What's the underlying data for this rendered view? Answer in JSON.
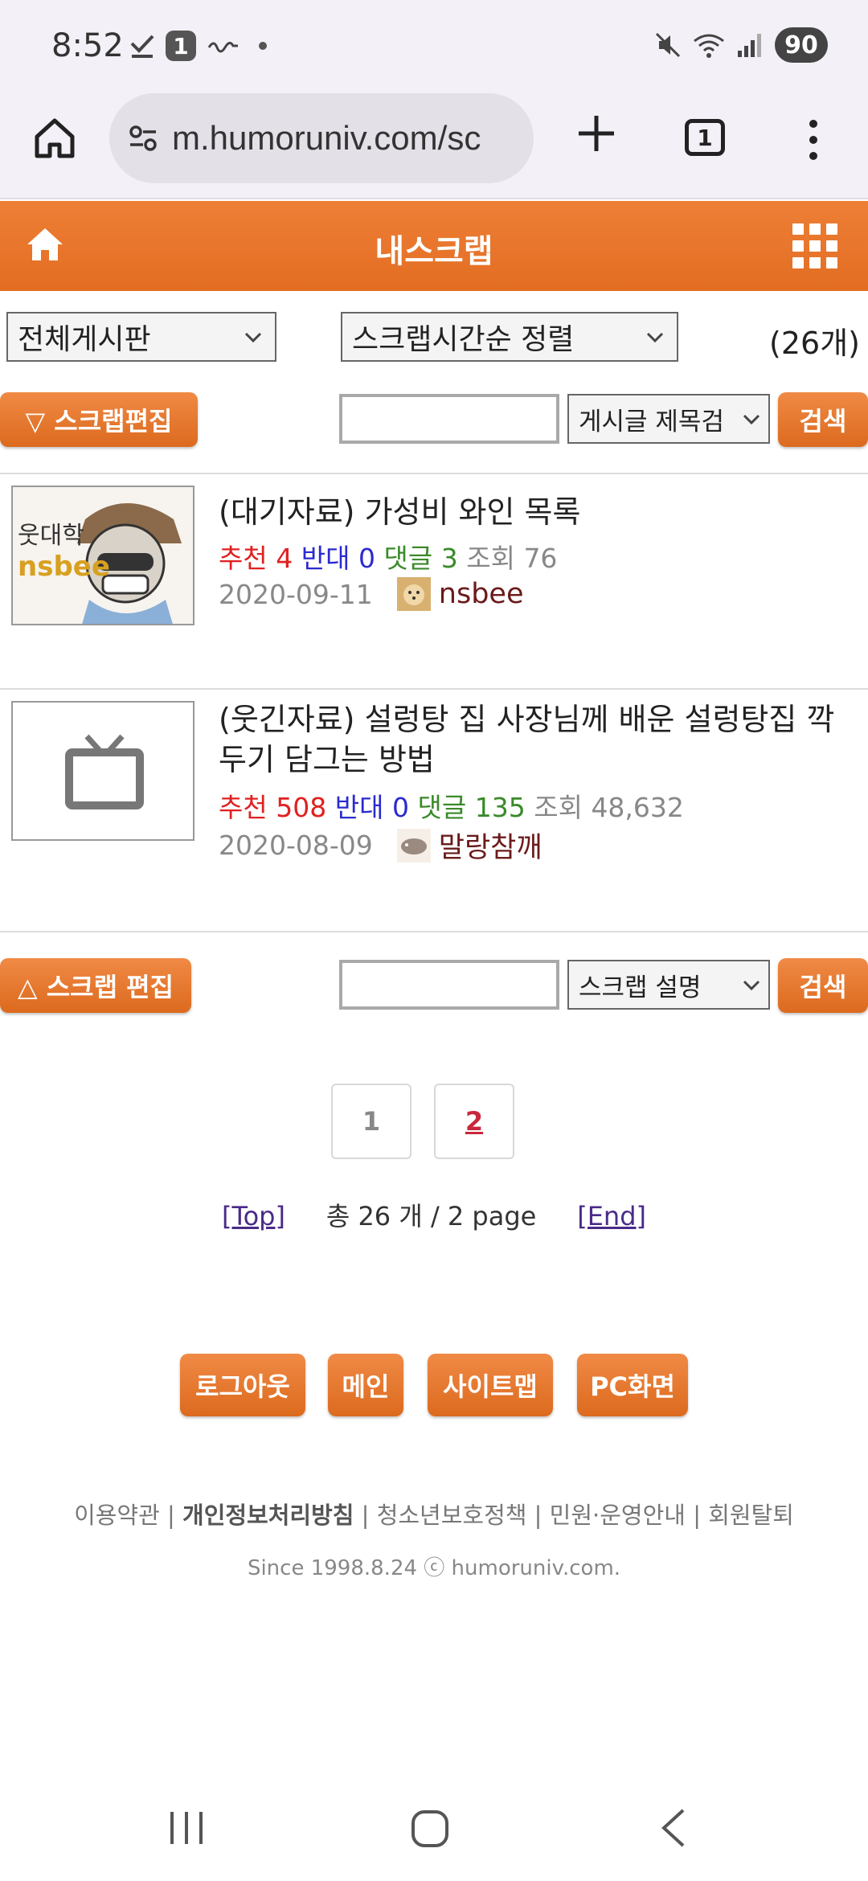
{
  "status": {
    "time": "8:52",
    "notif_badge": "1",
    "battery": "90"
  },
  "browser": {
    "url": "m.humoruniv.com/sc",
    "tab_count": "1"
  },
  "header": {
    "title": "내스크랩"
  },
  "filters": {
    "board_select": "전체게시판",
    "sort_select": "스크랩시간순 정렬",
    "count": "(26개)"
  },
  "top_actions": {
    "edit_button": "▽ 스크랩편집",
    "search_field_select": "게시글 제목검",
    "search_button": "검색",
    "search_placeholder": ""
  },
  "items": [
    {
      "title": "(대기자료) 가성비 와인 목록",
      "recommend_label": "추천",
      "recommend": "4",
      "oppose_label": "반대",
      "oppose": "0",
      "comments_label": "댓글",
      "comments": "3",
      "views_label": "조회",
      "views": "76",
      "date": "2020-09-11",
      "author": "nsbee",
      "thumb_text_1": "웃대학",
      "thumb_text_2": "nsbee"
    },
    {
      "title": "(웃긴자료) 설렁탕 집 사장님께 배운 설렁탕집 깍두기 담그는 방법",
      "recommend_label": "추천",
      "recommend": "508",
      "oppose_label": "반대",
      "oppose": "0",
      "comments_label": "댓글",
      "comments": "135",
      "views_label": "조회",
      "views": "48,632",
      "date": "2020-08-09",
      "author": "말랑참깨"
    }
  ],
  "bottom_actions": {
    "edit_button": "△ 스크랩 편집",
    "search_field_select": "스크랩 설명",
    "search_button": "검색"
  },
  "pagination": {
    "page1": "1",
    "page2": "2",
    "top_link": "[Top]",
    "summary": "총 26 개 / 2 page",
    "end_link": "[End]"
  },
  "footer_buttons": {
    "logout": "로그아웃",
    "main": "메인",
    "sitemap": "사이트맵",
    "pc": "PC화면"
  },
  "footer": {
    "terms": "이용약관",
    "privacy": "개인정보처리방침",
    "youth": "청소년보호정책",
    "support": "민원·운영안내",
    "withdraw": "회원탈퇴",
    "separator": " | ",
    "since": "Since 1998.8.24 ⓒ humoruniv.com."
  },
  "colors": {
    "brand_orange": "#e8762c",
    "status_bg": "#f3f1f7"
  }
}
